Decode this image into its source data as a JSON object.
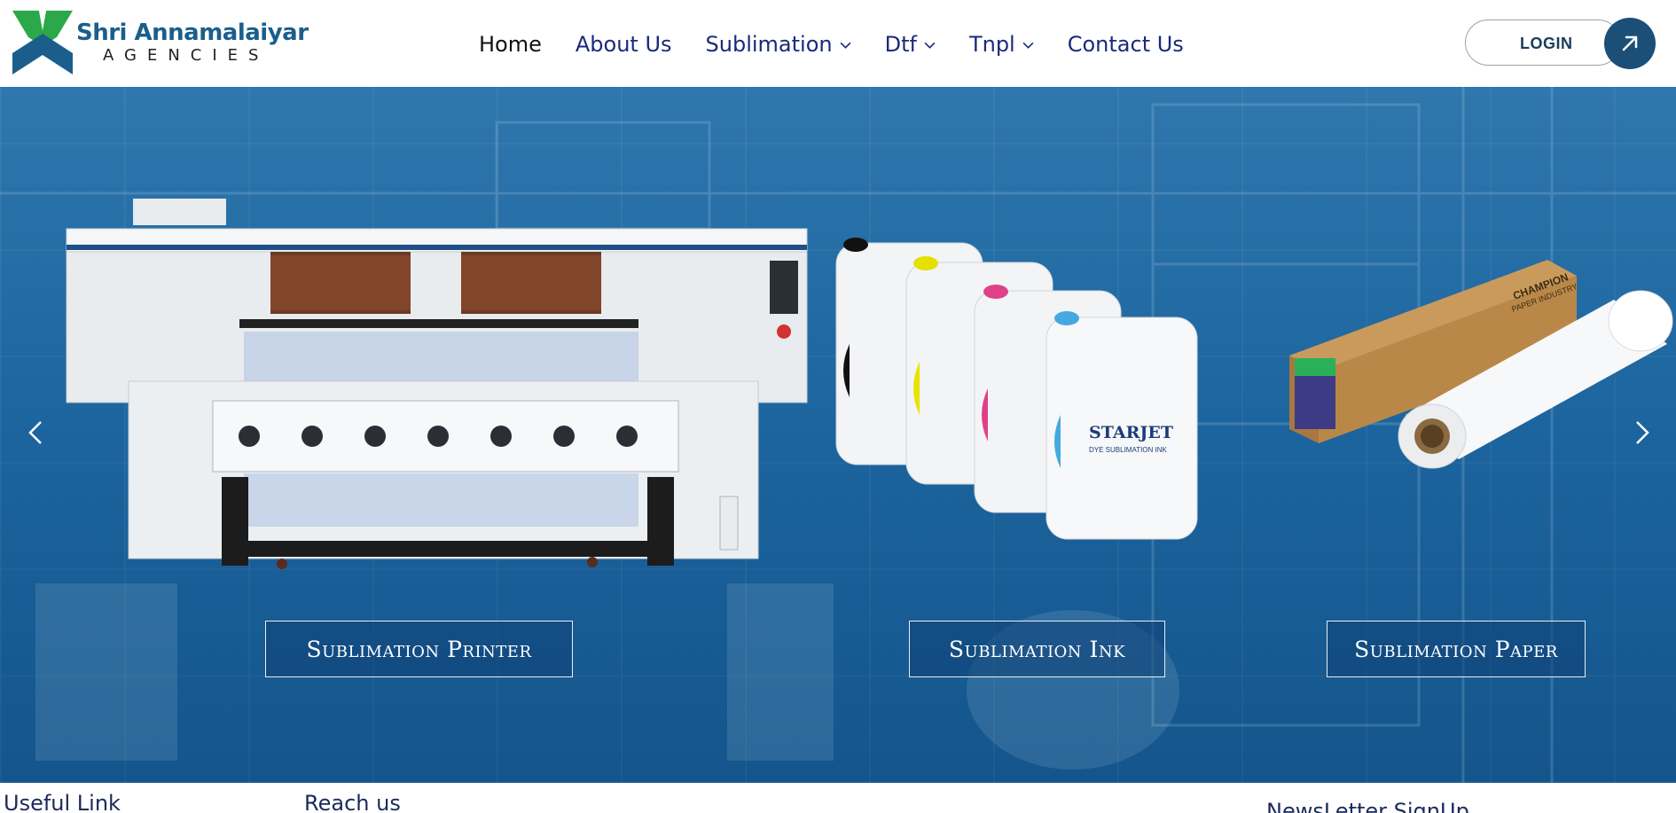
{
  "brand": {
    "name": "Shri Annamalaiyar",
    "sub": "AGENCIES",
    "colors": {
      "primary": "#1b5e8c",
      "accent_green": "#2aa84a",
      "nav_text": "#1a2a7a"
    }
  },
  "nav": {
    "items": [
      {
        "label": "Home",
        "active": true,
        "dropdown": false
      },
      {
        "label": "About Us",
        "active": false,
        "dropdown": false
      },
      {
        "label": "Sublimation",
        "active": false,
        "dropdown": true
      },
      {
        "label": "Dtf",
        "active": false,
        "dropdown": true
      },
      {
        "label": "Tnpl",
        "active": false,
        "dropdown": true
      },
      {
        "label": "Contact Us",
        "active": false,
        "dropdown": false
      }
    ]
  },
  "login": {
    "label": "LOGIN",
    "icon": "arrow-up-right-icon"
  },
  "hero": {
    "categories": [
      {
        "label": "Sublimation Printer"
      },
      {
        "label": "Sublimation Ink"
      },
      {
        "label": "Sublimation Paper"
      }
    ],
    "product_labels": {
      "ink_brand": "STARJET",
      "ink_type": "DYE SUBLIMATION INK",
      "ink_colors": [
        "BLACK",
        "YELLOW",
        "MAGENTA",
        "CYAN"
      ],
      "paper_box_brand": "CHAMPION",
      "paper_box_sub": "PAPER INDUSTRY"
    },
    "prev_icon": "chevron-left-icon",
    "next_icon": "chevron-right-icon"
  },
  "footer": {
    "useful_link": "Useful Link",
    "reach_us": "Reach us",
    "newsletter": "NewsLetter SignUp"
  }
}
